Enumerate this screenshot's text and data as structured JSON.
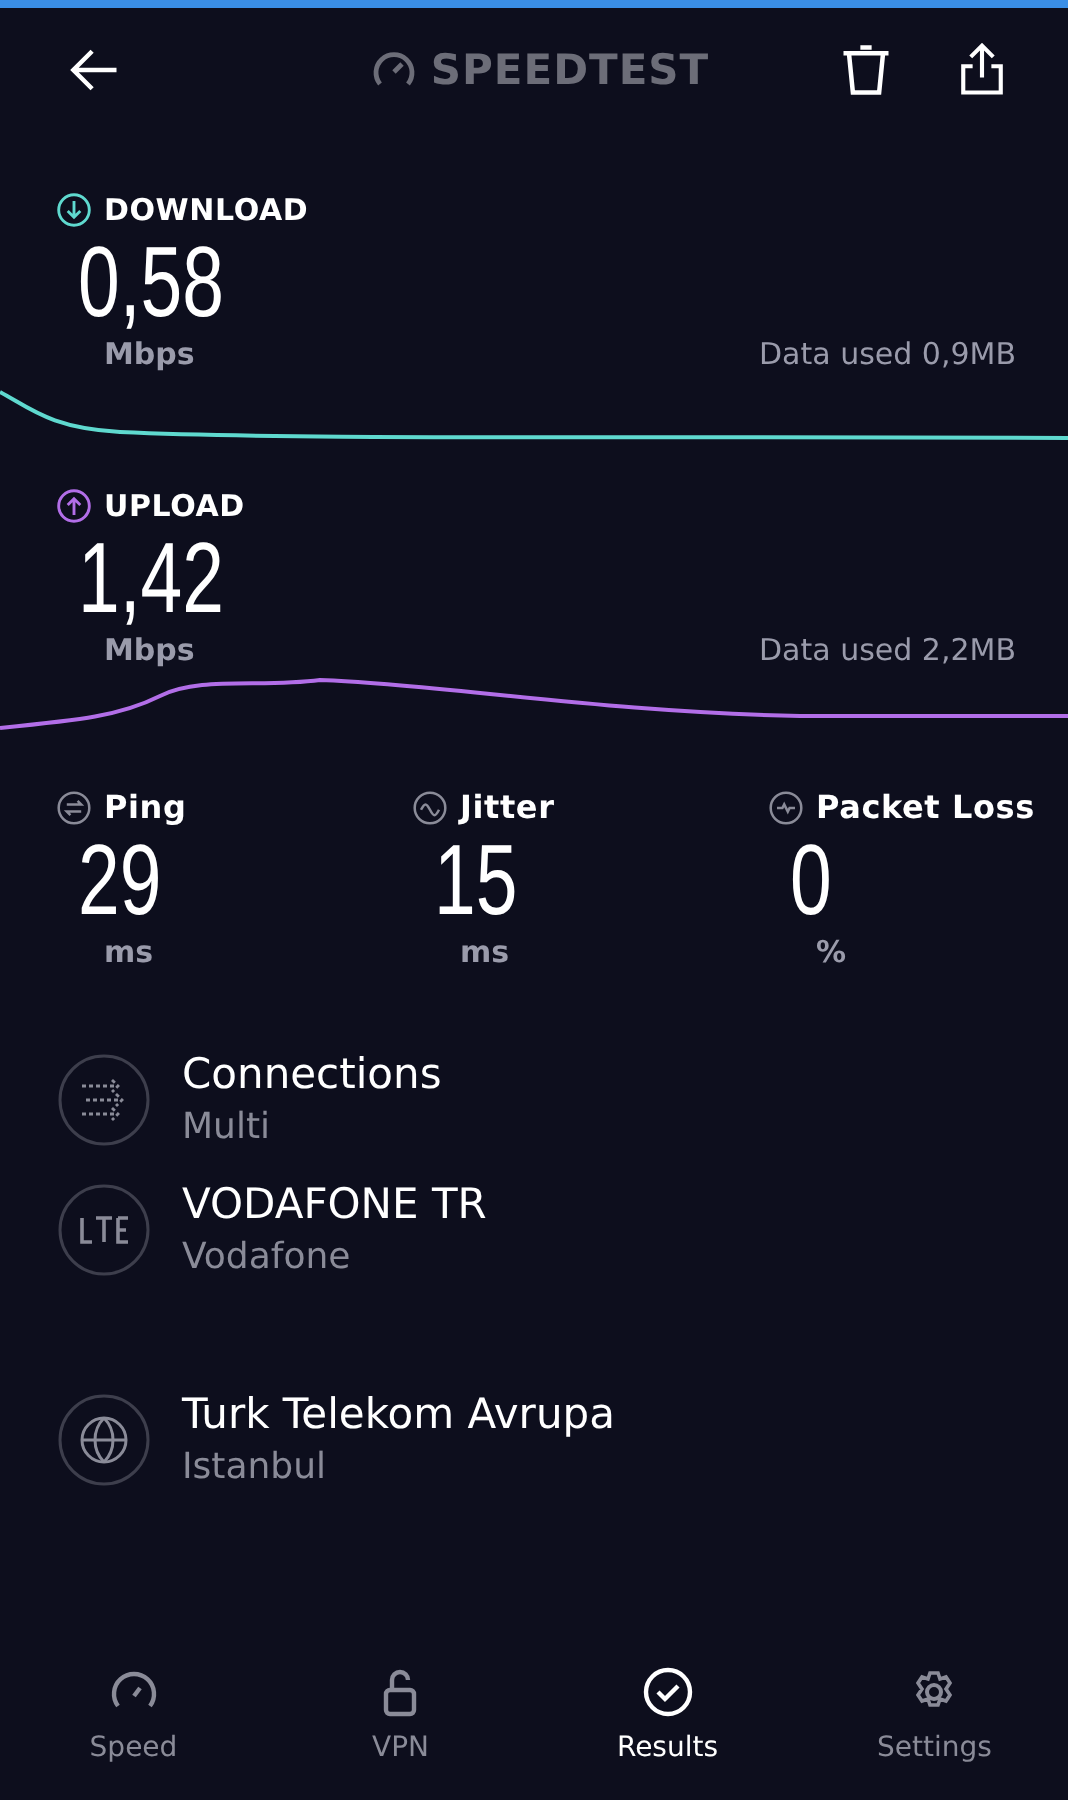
{
  "header": {
    "logo": "SPEEDTEST"
  },
  "speeds": [
    {
      "kind": "download",
      "label": "DOWNLOAD",
      "value": "0,58",
      "unit": "Mbps",
      "data_used": "Data used 0,9MB",
      "color": "#5fd9cf"
    },
    {
      "kind": "upload",
      "label": "UPLOAD",
      "value": "1,42",
      "unit": "Mbps",
      "data_used": "Data used 2,2MB",
      "color": "#b26ee8"
    }
  ],
  "metrics": [
    {
      "kind": "ping",
      "label": "Ping",
      "value": "29",
      "unit": "ms"
    },
    {
      "kind": "jitter",
      "label": "Jitter",
      "value": "15",
      "unit": "ms"
    },
    {
      "kind": "loss",
      "label": "Packet Loss",
      "value": "0",
      "unit": "%"
    }
  ],
  "details": [
    {
      "kind": "connections",
      "title": "Connections",
      "subtitle": "Multi"
    },
    {
      "kind": "lte",
      "title": "VODAFONE TR",
      "subtitle": "Vodafone"
    },
    {
      "kind": "server",
      "title": "Turk Telekom Avrupa",
      "subtitle": "Istanbul"
    }
  ],
  "tabs": [
    {
      "kind": "speed",
      "label": "Speed",
      "selected": false
    },
    {
      "kind": "vpn",
      "label": "VPN",
      "selected": false
    },
    {
      "kind": "results",
      "label": "Results",
      "selected": true
    },
    {
      "kind": "settings",
      "label": "Settings",
      "selected": false
    }
  ]
}
